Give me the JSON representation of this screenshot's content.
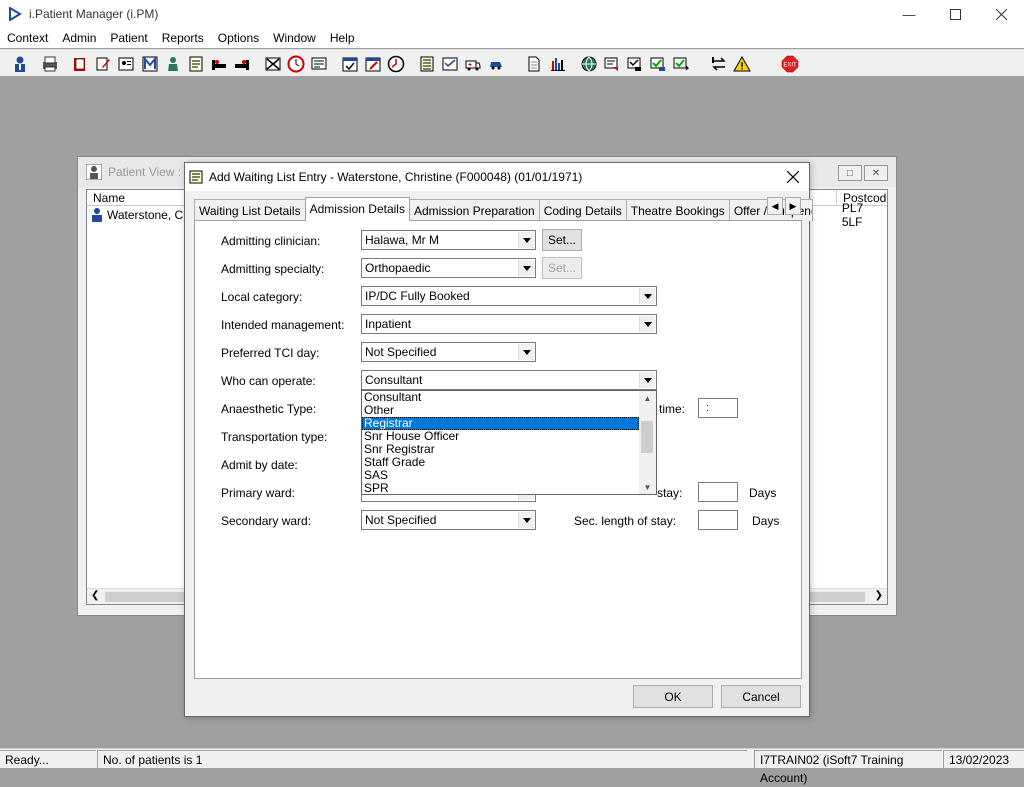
{
  "app": {
    "title": "i.Patient Manager (i.PM)"
  },
  "menu": [
    "Context",
    "Admin",
    "Patient",
    "Reports",
    "Options",
    "Window",
    "Help"
  ],
  "toolbar_icons": [
    "user-icon",
    "print-icon",
    "book-icon",
    "edit-doc-icon",
    "id-card-icon",
    "letter-m-icon",
    "person-icon",
    "notes-icon",
    "bed-icon",
    "bed-alt-icon",
    "no-entry-icon",
    "clock-icon",
    "monitor-icon",
    "calendar-check-icon",
    "calendar-edit-icon",
    "clock-alt-icon",
    "list-icon",
    "tick-list-icon",
    "ambulance-icon",
    "car-icon",
    "page-icon",
    "bar-chart-icon",
    "globe-icon",
    "flag-icon",
    "flag-check-icon",
    "flag-green-icon",
    "flag-forward-icon",
    "swap-icon",
    "warning-icon",
    "exit-icon"
  ],
  "exit_label": "EXIT",
  "patient_view": {
    "title": "Patient View :",
    "columns": {
      "name": "Name",
      "postcode": "Postcod"
    },
    "row": {
      "name": "Waterstone, Chr",
      "postcode": "PL7 5LF"
    }
  },
  "dialog": {
    "title": "Add Waiting List Entry - Waterstone, Christine (F000048) (01/01/1971)",
    "tabs": [
      "Waiting List Details",
      "Admission Details",
      "Admission Preparation",
      "Coding Details",
      "Theatre Bookings",
      "Offer / Suspend"
    ],
    "active_tab": "Admission Details",
    "fields": {
      "admitting_clinician": {
        "label": "Admitting clinician:",
        "value": "Halawa, Mr M",
        "button": "Set..."
      },
      "admitting_specialty": {
        "label": "Admitting specialty:",
        "value": "Orthopaedic",
        "button": "Set..."
      },
      "local_category": {
        "label": "Local category:",
        "value": "IP/DC Fully Booked"
      },
      "intended_management": {
        "label": "Intended management:",
        "value": "Inpatient"
      },
      "preferred_tci_day": {
        "label": "Preferred TCI day:",
        "value": "Not Specified"
      },
      "who_can_operate": {
        "label": "Who can operate:",
        "value": "Consultant"
      },
      "anaesthetic_type": {
        "label": "Anaesthetic Type:"
      },
      "transportation_type": {
        "label": "Transportation type:"
      },
      "admit_by_date": {
        "label": "Admit by date:"
      },
      "primary_ward": {
        "label": "Primary ward:"
      },
      "secondary_ward": {
        "label": "Secondary ward:",
        "value": "Not Specified"
      },
      "time": {
        "label": "time:",
        "value": ":"
      },
      "length_of_stay": {
        "label": "stay:",
        "unit": "Days"
      },
      "sec_length_of_stay": {
        "label": "Sec. length of stay:",
        "unit": "Days"
      }
    },
    "dropdown_options": [
      "Consultant",
      "Other",
      "Registrar",
      "Snr House Officer",
      "Snr Registrar",
      "Staff Grade",
      "SAS",
      "SPR"
    ],
    "dropdown_selected": "Registrar",
    "ok": "OK",
    "cancel": "Cancel"
  },
  "status": {
    "ready": "Ready...",
    "patients": "No. of patients is 1",
    "account": "I7TRAIN02 (iSoft7 Training Account)",
    "date": "13/02/2023"
  },
  "colors": {
    "selection": "#0078d7",
    "exit_red": "#e02020"
  }
}
